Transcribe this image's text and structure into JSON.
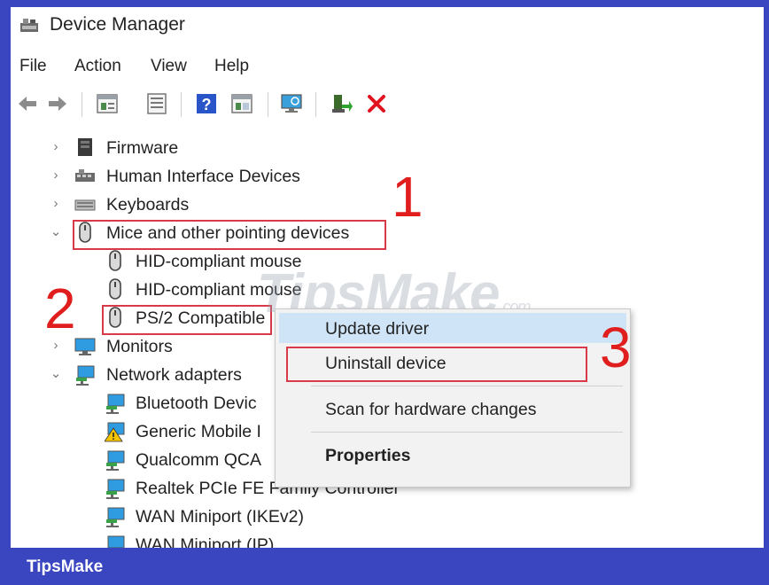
{
  "window": {
    "title": "Device Manager"
  },
  "menu": [
    "File",
    "Action",
    "View",
    "Help"
  ],
  "toolbar": {
    "icons": [
      "back-arrow-icon",
      "forward-arrow-icon",
      "properties-icon",
      "list-view-icon",
      "help-icon",
      "panel-view-icon",
      "monitor-scan-icon",
      "enable-device-icon",
      "uninstall-x-icon"
    ]
  },
  "tree": [
    {
      "label": "Firmware",
      "expander": "›",
      "icon": "firmware-chip-icon"
    },
    {
      "label": "Human Interface Devices",
      "expander": "›",
      "icon": "hid-icon"
    },
    {
      "label": "Keyboards",
      "expander": "›",
      "icon": "keyboard-icon"
    },
    {
      "label": "Mice and other pointing devices",
      "expander": "⌄",
      "icon": "mouse-icon"
    },
    {
      "label": "HID-compliant mouse",
      "icon": "mouse-icon"
    },
    {
      "label": "HID-compliant mouse",
      "icon": "mouse-icon"
    },
    {
      "label": "PS/2 Compatible",
      "icon": "mouse-icon"
    },
    {
      "label": "Monitors",
      "expander": "›",
      "icon": "monitor-icon"
    },
    {
      "label": "Network adapters",
      "expander": "⌄",
      "icon": "network-icon"
    },
    {
      "label": "Bluetooth Devic",
      "icon": "network-icon"
    },
    {
      "label": "Generic Mobile I",
      "icon": "network-warning-icon"
    },
    {
      "label": "Qualcomm QCA",
      "icon": "network-icon"
    },
    {
      "label": "Realtek PCIe FE Family Controller",
      "icon": "network-icon"
    },
    {
      "label": "WAN Miniport (IKEv2)",
      "icon": "network-icon"
    },
    {
      "label": "WAN Miniport (IP)",
      "icon": "network-icon"
    }
  ],
  "context_menu": {
    "update": "Update driver",
    "uninstall": "Uninstall device",
    "scan": "Scan for hardware changes",
    "properties": "Properties"
  },
  "annotations": {
    "step1": "1",
    "step2": "2",
    "step3": "3"
  },
  "watermark": {
    "text": "TipsMake",
    "suffix": ".com"
  },
  "footer": {
    "brand": "TipsMake"
  },
  "colors": {
    "highlight_box": "#d83a4a",
    "step_number": "#e01e1e",
    "footer_bg": "#3a46c0",
    "menu_hover": "#cfe4f7"
  }
}
